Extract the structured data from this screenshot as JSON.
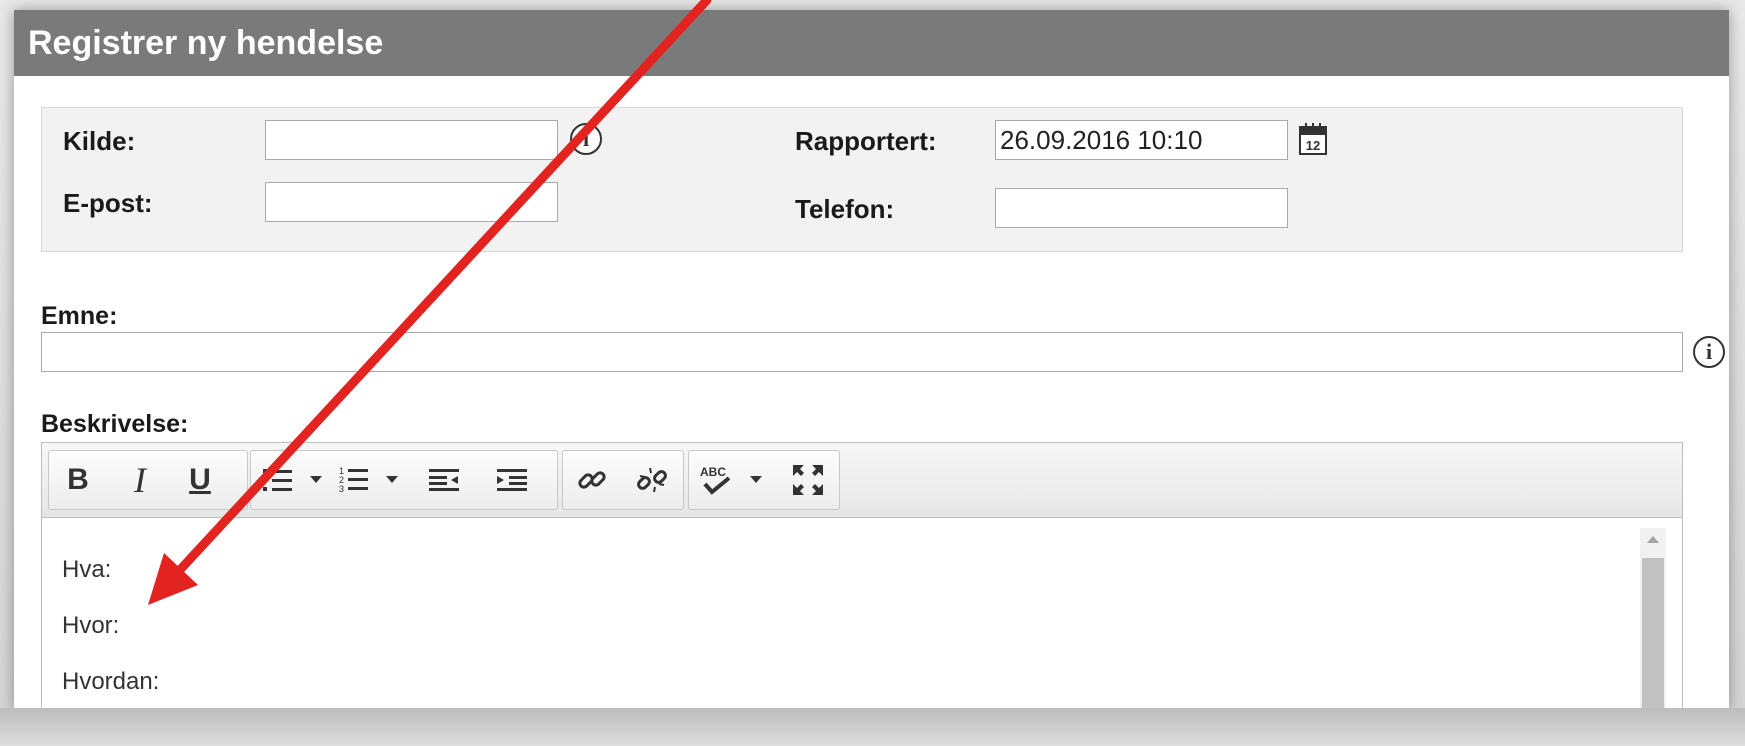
{
  "dialog": {
    "title": "Registrer ny hendelse"
  },
  "form": {
    "kilde_label": "Kilde:",
    "kilde_value": "",
    "epost_label": "E-post:",
    "epost_value": "",
    "rapportert_label": "Rapportert:",
    "rapportert_value": "26.09.2016 10:10",
    "telefon_label": "Telefon:",
    "telefon_value": "",
    "emne_label": "Emne:",
    "emne_value": "",
    "beskrivelse_label": "Beskrivelse:"
  },
  "toolbar": {
    "bold_label": "B",
    "italic_label": "I",
    "underline_label": "U",
    "icons": [
      "bold-icon",
      "italic-icon",
      "underline-icon",
      "bullet-list-icon",
      "numbered-list-icon",
      "outdent-icon",
      "indent-icon",
      "link-icon",
      "unlink-icon",
      "spellcheck-icon",
      "maximize-icon"
    ]
  },
  "editor": {
    "lines": [
      "Hva:",
      "Hvor:",
      "Hvordan:"
    ]
  },
  "colors": {
    "titlebar_bg": "#7a7a7a",
    "annotation_arrow": "#e3231f"
  }
}
